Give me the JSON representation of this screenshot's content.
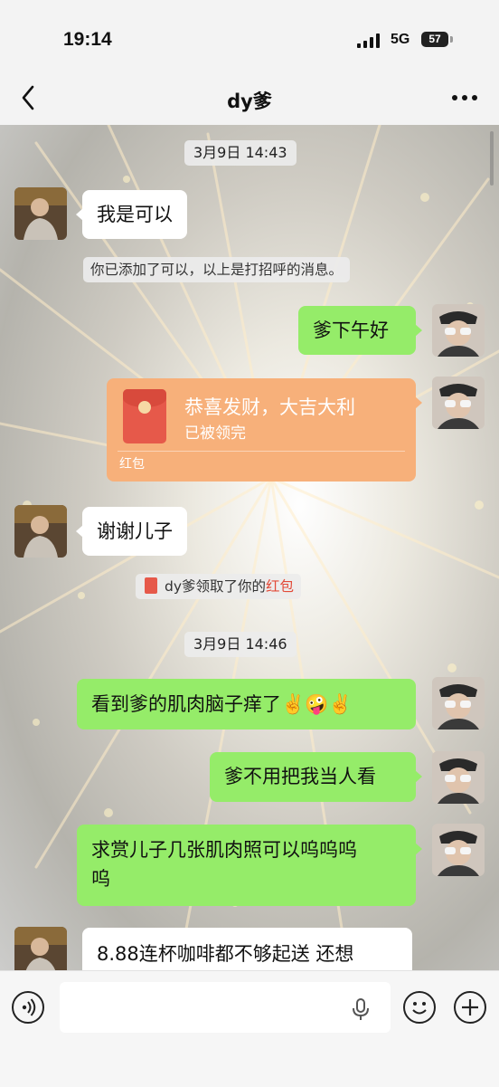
{
  "status": {
    "time": "19:14",
    "network": "5G",
    "battery": "57"
  },
  "header": {
    "title": "dy爹"
  },
  "messages": {
    "ts1": "3月9日 14:43",
    "m1": "我是可以",
    "sys1": "你已添加了可以，以上是打招呼的消息。",
    "m2": "爹下午好",
    "redpacket": {
      "title": "恭喜发财，大吉大利",
      "status": "已被领完",
      "label": "红包"
    },
    "m3": "谢谢儿子",
    "sys2_prefix": "dy爹领取了你的",
    "sys2_link": "红包",
    "ts2": "3月9日 14:46",
    "m4": "看到爹的肌肉脑子痒了✌️🤪✌️",
    "m5": "爹不用把我当人看",
    "m6_line1": "求赏儿子几张肌肉照可以呜呜呜",
    "m6_line2": "呜",
    "m7": "8.88连杯咖啡都不够起送 还想"
  },
  "icons": {
    "back": "chevron-left-icon",
    "more": "more-dots-icon",
    "voice": "voice-icon",
    "mic": "microphone-icon",
    "emoji": "emoji-icon",
    "plus": "plus-icon"
  },
  "colors": {
    "sent_bubble": "#95ec69",
    "received_bubble": "#ffffff",
    "red_packet": "#f7b07a",
    "red_text": "#e24a38"
  }
}
